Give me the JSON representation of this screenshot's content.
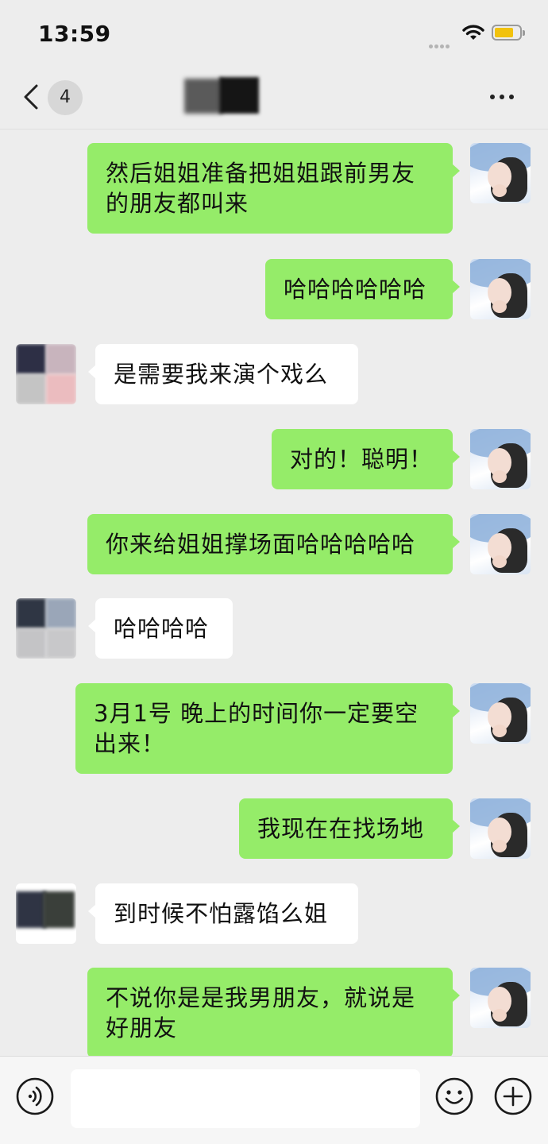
{
  "status_bar": {
    "time": "13:59"
  },
  "nav": {
    "unread_count": "4",
    "more_label": "more"
  },
  "messages": [
    {
      "sender": "me",
      "text": "然后姐姐准备把姐姐跟前男友的朋友都叫来"
    },
    {
      "sender": "me",
      "text": "哈哈哈哈哈哈"
    },
    {
      "sender": "other",
      "text": "是需要我来演个戏么"
    },
    {
      "sender": "me",
      "text": "对的！聪明！"
    },
    {
      "sender": "me",
      "text": "你来给姐姐撑场面哈哈哈哈哈"
    },
    {
      "sender": "other",
      "text": "哈哈哈哈"
    },
    {
      "sender": "me",
      "text": "3月1号 晚上的时间你一定要空出来！"
    },
    {
      "sender": "me",
      "text": "我现在在找场地"
    },
    {
      "sender": "other",
      "text": "到时候不怕露馅么姐"
    },
    {
      "sender": "me",
      "text": "不说你是是我男朋友，就说是好朋友"
    }
  ],
  "input": {
    "placeholder": "",
    "value": ""
  },
  "colors": {
    "my_bubble": "#95ec69",
    "their_bubble": "#ffffff",
    "background": "#ededed",
    "battery": "#f2c20c"
  },
  "icons": [
    "back-chevron-icon",
    "wifi-icon",
    "battery-icon",
    "more-dots-icon",
    "voice-icon",
    "emoji-icon",
    "plus-icon"
  ]
}
